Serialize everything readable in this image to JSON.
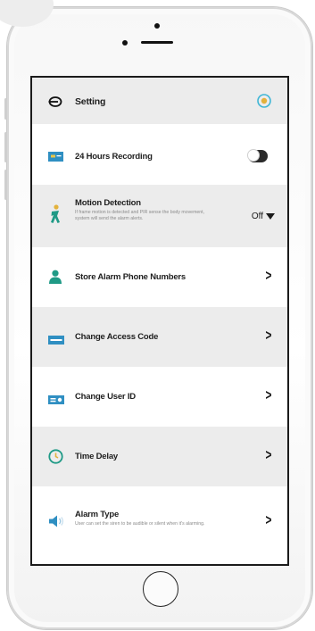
{
  "header": {
    "title": "Setting",
    "back_icon": "back-arrow-icon",
    "status_icon": "status-indicator-icon",
    "accent": "#3fb6d6"
  },
  "rows": {
    "recording": {
      "title": "24 Hours Recording",
      "icon": "recording-card-icon",
      "toggle": "off"
    },
    "motion": {
      "title": "Motion Detection",
      "desc": "If frame motion is detected and PIR sense the body movement, system will send the alarm alerts.",
      "value": "Off",
      "icon": "motion-person-icon"
    },
    "phone_numbers": {
      "title": "Store Alarm Phone Numbers",
      "icon": "person-icon"
    },
    "access_code": {
      "title": "Change Access Code",
      "icon": "code-card-icon"
    },
    "user_id": {
      "title": "Change User ID",
      "icon": "id-card-icon"
    },
    "time_delay": {
      "title": "Time Delay",
      "icon": "clock-icon"
    },
    "alarm_type": {
      "title": "Alarm Type",
      "desc": "User can set the siren to be audible or silent when it's alarming.",
      "icon": "speaker-icon"
    }
  },
  "colors": {
    "icon_blue": "#2f8fc2",
    "icon_green": "#1f9a86",
    "row_gray": "#ececec"
  }
}
